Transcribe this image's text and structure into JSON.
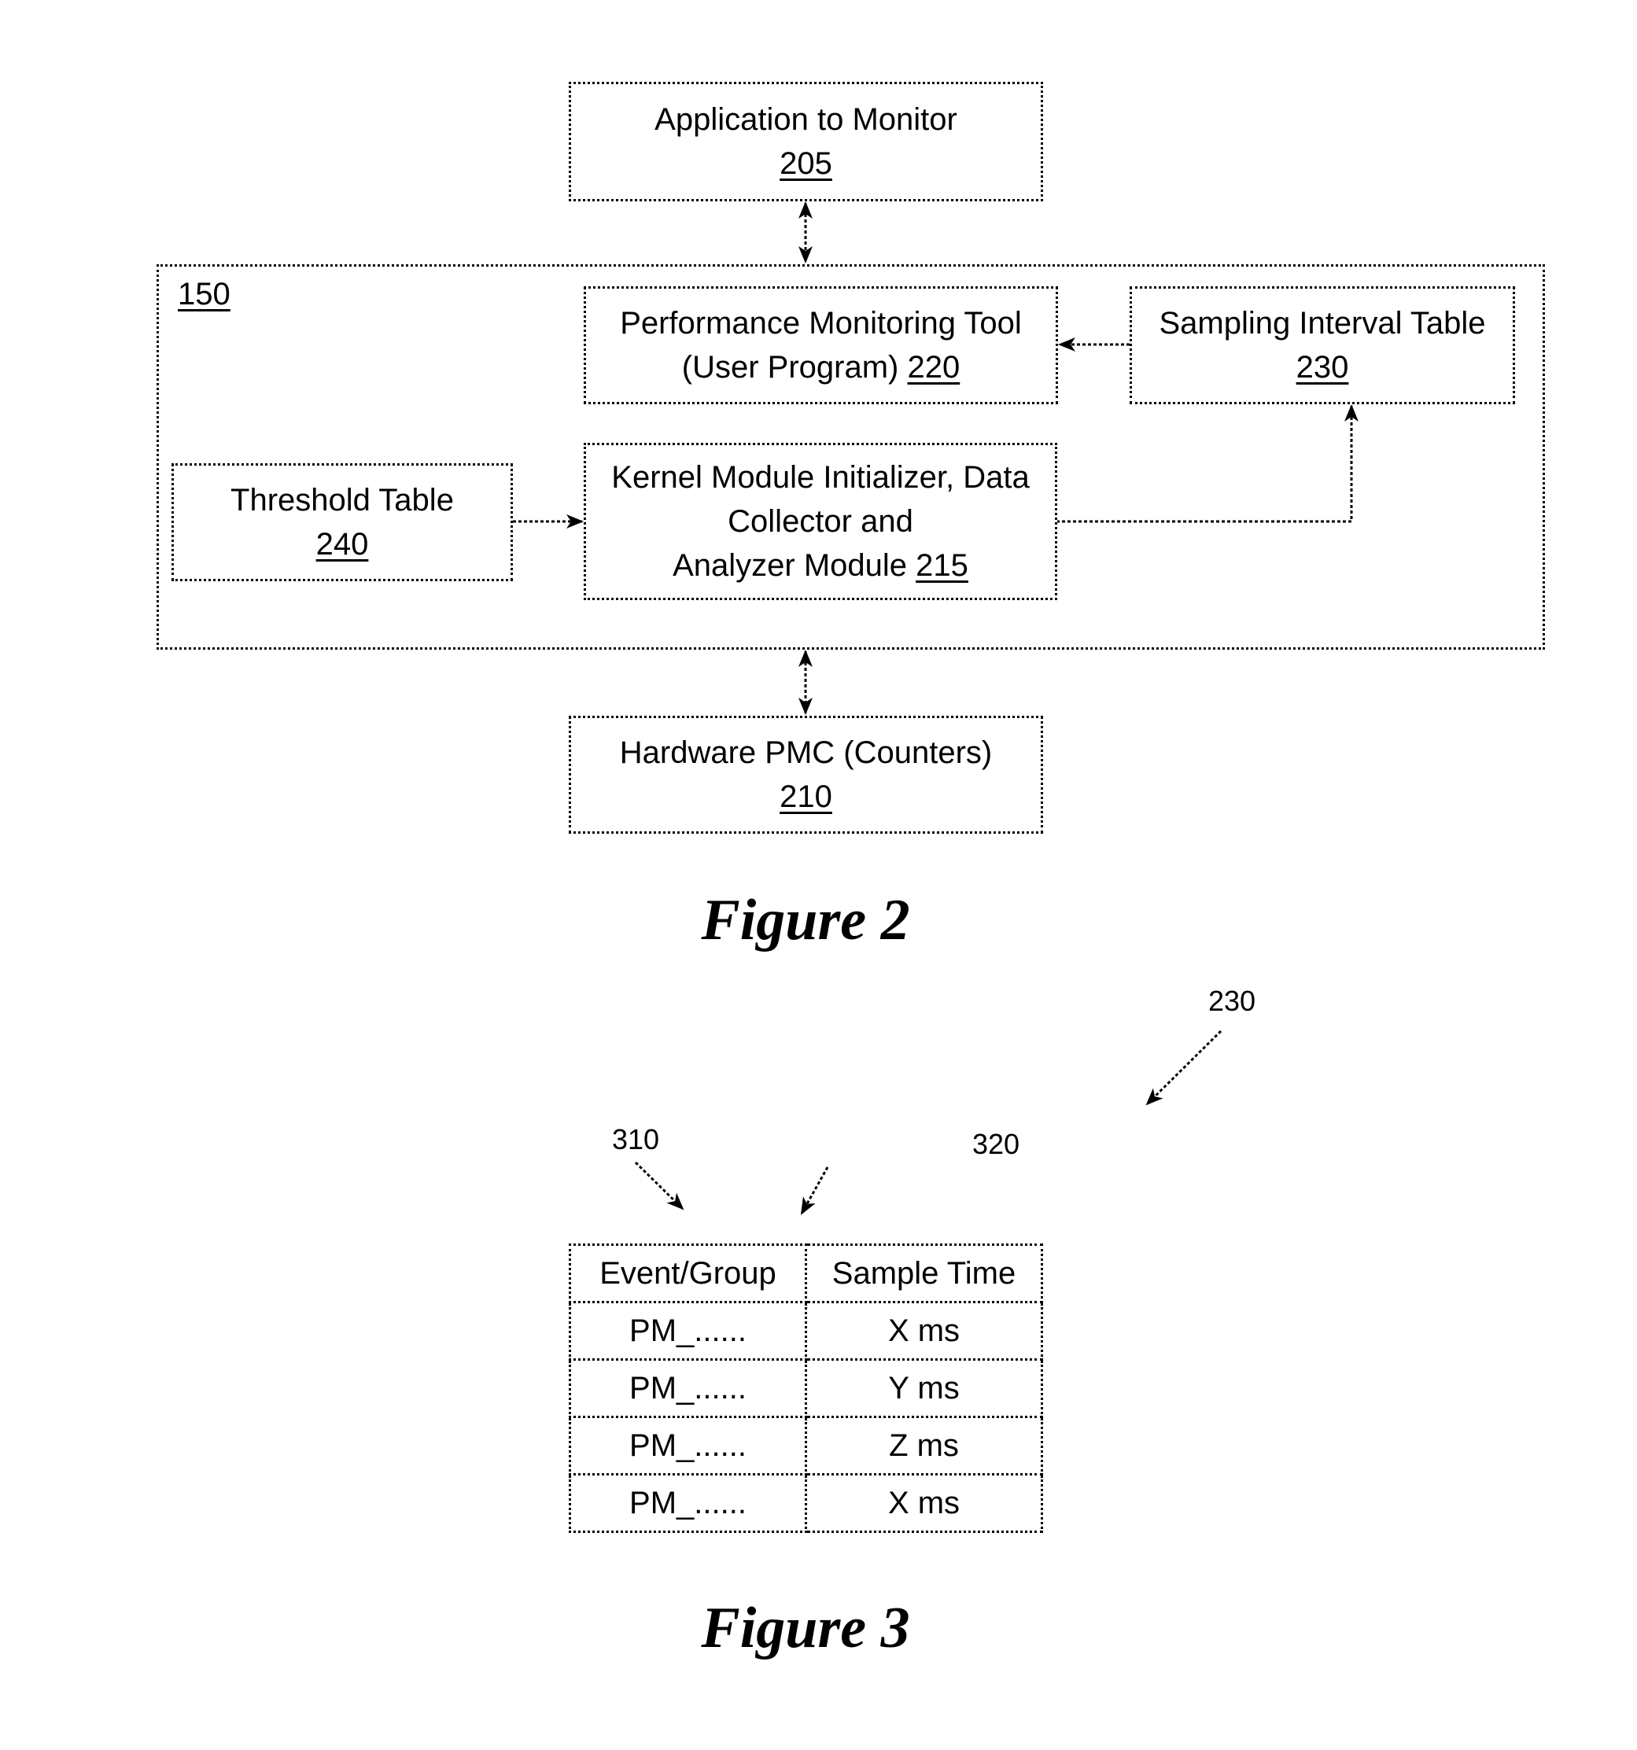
{
  "figure2": {
    "caption": "Figure 2",
    "system_ref": "150",
    "application": {
      "title": "Application to Monitor",
      "ref": "205"
    },
    "perf_tool": {
      "line1": "Performance Monitoring Tool",
      "line2": "(User Program)",
      "ref": "220"
    },
    "sampling_table": {
      "title": "Sampling Interval Table",
      "ref": "230"
    },
    "threshold_table": {
      "title": "Threshold Table",
      "ref": "240"
    },
    "kernel_module": {
      "line1": "Kernel Module Initializer, Data",
      "line2": "Collector and",
      "line3": "Analyzer Module",
      "ref": "215"
    },
    "hardware_pmc": {
      "title": "Hardware PMC (Counters)",
      "ref": "210"
    }
  },
  "figure3": {
    "caption": "Figure 3",
    "table_ref": "230",
    "column1_ref": "310",
    "column2_ref": "320",
    "headers": [
      "Event/Group",
      "Sample Time"
    ],
    "rows": [
      [
        "PM_......",
        "X ms"
      ],
      [
        "PM_......",
        "Y ms"
      ],
      [
        "PM_......",
        "Z ms"
      ],
      [
        "PM_......",
        "X ms"
      ]
    ]
  }
}
